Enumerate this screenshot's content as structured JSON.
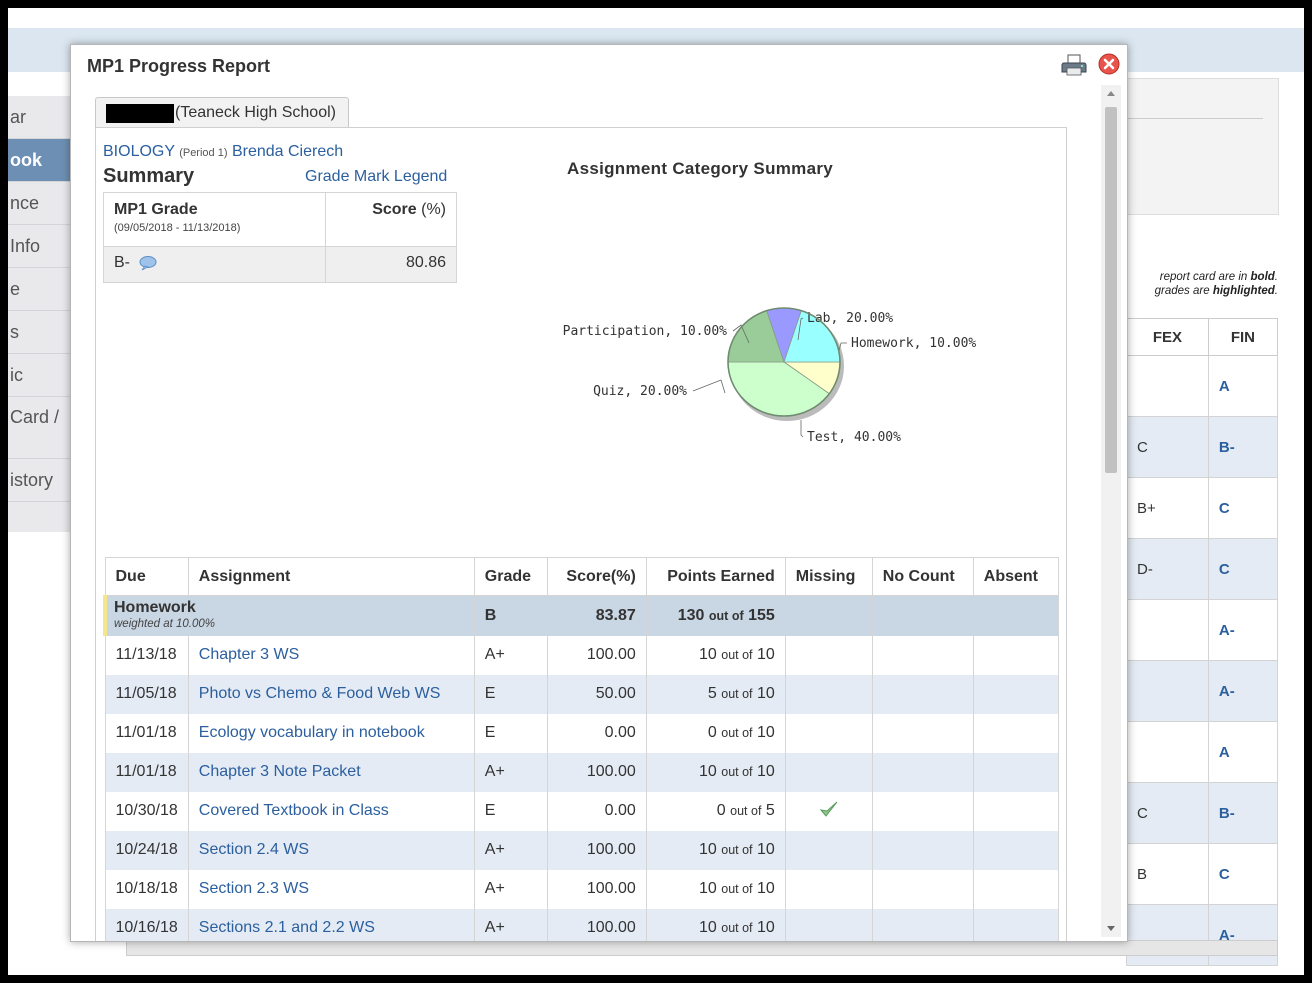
{
  "background": {
    "sidebar_items": [
      "ar",
      "ook",
      "nce",
      "Info",
      "e",
      "s",
      "ic",
      "Card /",
      "istory"
    ],
    "notes": [
      {
        "pre": "report card are in ",
        "em": "bold",
        "post": "."
      },
      {
        "pre": "grades are ",
        "em": "highlighted",
        "post": "."
      }
    ],
    "grade_table": {
      "headers": [
        "FEX",
        "FIN"
      ],
      "rows": [
        {
          "fex": "",
          "fin": "A"
        },
        {
          "fex": "C",
          "fin": "B-"
        },
        {
          "fex": "B+",
          "fin": "C"
        },
        {
          "fex": "D-",
          "fin": "C"
        },
        {
          "fex": "",
          "fin": "A-"
        },
        {
          "fex": "",
          "fin": "A-"
        },
        {
          "fex": "",
          "fin": "A"
        },
        {
          "fex": "C",
          "fin": "B-"
        },
        {
          "fex": "B",
          "fin": "C"
        },
        {
          "fex": "",
          "fin": "A-"
        }
      ]
    }
  },
  "modal": {
    "title": "MP1 Progress Report",
    "student_tab": "(Teaneck High School)",
    "course": {
      "name": "BIOLOGY",
      "period": "(Period 1)",
      "teacher": "Brenda Cierech"
    },
    "summary_title": "Summary",
    "legend_link": "Grade Mark Legend",
    "grade_box": {
      "label": "MP1 Grade",
      "dates": "(09/05/2018 - 11/13/2018)",
      "score_header": "Score",
      "score_unit": "(%)",
      "grade": "B-",
      "score": "80.86"
    }
  },
  "chart_data": {
    "type": "pie",
    "title": "Assignment Category Summary",
    "slices": [
      {
        "label": "Homework, 10.00%",
        "name": "Homework",
        "value": 10,
        "color": "#ffffcc"
      },
      {
        "label": "Test, 40.00%",
        "name": "Test",
        "value": 40,
        "color": "#ccffcc"
      },
      {
        "label": "Quiz, 20.00%",
        "name": "Quiz",
        "value": 20,
        "color": "#99cc99"
      },
      {
        "label": "Participation, 10.00%",
        "name": "Participation",
        "value": 10,
        "color": "#9999ff"
      },
      {
        "label": "Lab, 20.00%",
        "name": "Lab",
        "value": 20,
        "color": "#99ffff"
      }
    ]
  },
  "assignments": {
    "headers": [
      "Due",
      "Assignment",
      "Grade",
      "Score(%)",
      "Points Earned",
      "Missing",
      "No Count",
      "Absent"
    ],
    "category": {
      "name": "Homework",
      "weight": "weighted at 10.00%",
      "grade": "B",
      "score": "83.87",
      "earned": "130",
      "out_of": "out of",
      "possible": "155"
    },
    "rows": [
      {
        "due": "11/13/18",
        "name": "Chapter 3 WS",
        "grade": "A+",
        "score": "100.00",
        "earned": "10",
        "out_of": "out of",
        "possible": "10",
        "missing": false
      },
      {
        "due": "11/05/18",
        "name": "Photo vs Chemo & Food Web WS",
        "grade": "E",
        "score": "50.00",
        "earned": "5",
        "out_of": "out of",
        "possible": "10",
        "missing": false
      },
      {
        "due": "11/01/18",
        "name": "Ecology vocabulary in notebook",
        "grade": "E",
        "score": "0.00",
        "earned": "0",
        "out_of": "out of",
        "possible": "10",
        "missing": false
      },
      {
        "due": "11/01/18",
        "name": "Chapter 3 Note Packet",
        "grade": "A+",
        "score": "100.00",
        "earned": "10",
        "out_of": "out of",
        "possible": "10",
        "missing": false
      },
      {
        "due": "10/30/18",
        "name": "Covered Textbook in Class",
        "grade": "E",
        "score": "0.00",
        "earned": "0",
        "out_of": "out of",
        "possible": "5",
        "missing": true
      },
      {
        "due": "10/24/18",
        "name": "Section 2.4 WS",
        "grade": "A+",
        "score": "100.00",
        "earned": "10",
        "out_of": "out of",
        "possible": "10",
        "missing": false
      },
      {
        "due": "10/18/18",
        "name": "Section 2.3 WS",
        "grade": "A+",
        "score": "100.00",
        "earned": "10",
        "out_of": "out of",
        "possible": "10",
        "missing": false
      },
      {
        "due": "10/16/18",
        "name": "Sections 2.1 and 2.2 WS",
        "grade": "A+",
        "score": "100.00",
        "earned": "10",
        "out_of": "out of",
        "possible": "10",
        "missing": false
      }
    ]
  }
}
